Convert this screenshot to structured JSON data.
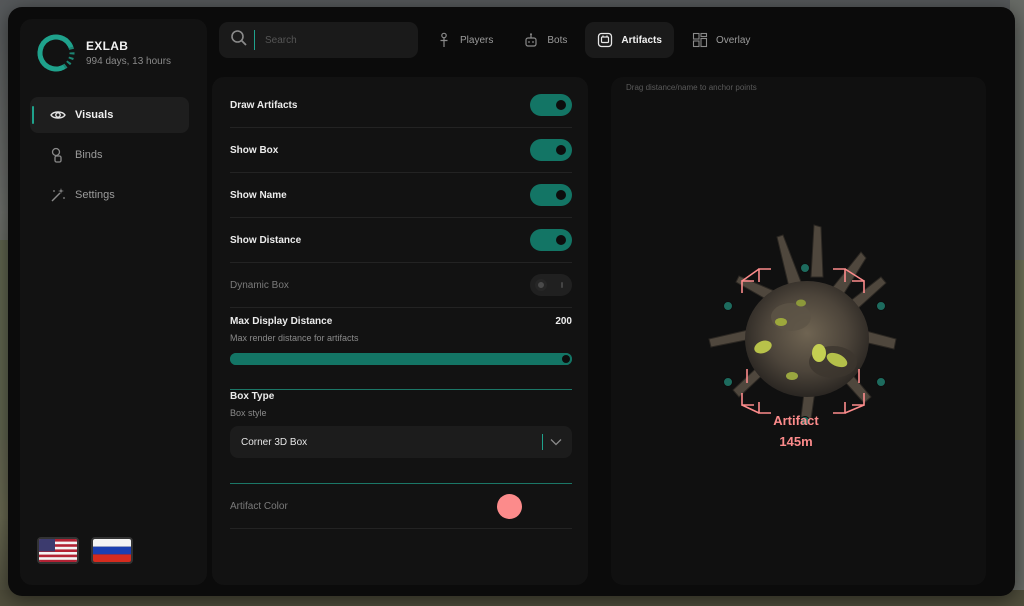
{
  "brand": {
    "name": "EXLAB",
    "subtitle": "994 days, 13 hours",
    "accent_color": "#1fa28c"
  },
  "sidebar": {
    "items": [
      {
        "label": "Visuals",
        "icon": "eye-icon",
        "active": true
      },
      {
        "label": "Binds",
        "icon": "keychain-icon",
        "active": false
      },
      {
        "label": "Settings",
        "icon": "magic-wand-icon",
        "active": false
      }
    ],
    "languages": [
      {
        "icon": "us-flag-icon"
      },
      {
        "icon": "ru-flag-icon"
      }
    ]
  },
  "search": {
    "placeholder": "Search",
    "value": ""
  },
  "tabs": [
    {
      "label": "Players",
      "icon": "player-icon",
      "active": false
    },
    {
      "label": "Bots",
      "icon": "bot-icon",
      "active": false
    },
    {
      "label": "Artifacts",
      "icon": "artifact-icon",
      "active": true
    },
    {
      "label": "Overlay",
      "icon": "overlay-icon",
      "active": false
    }
  ],
  "settings": {
    "draw_artifacts": {
      "label": "Draw Artifacts",
      "enabled": true
    },
    "show_box": {
      "label": "Show Box",
      "enabled": true
    },
    "show_name": {
      "label": "Show Name",
      "enabled": true
    },
    "show_distance": {
      "label": "Show Distance",
      "enabled": true
    },
    "dynamic_box": {
      "label": "Dynamic Box",
      "enabled": false,
      "disabled": true
    },
    "max_distance": {
      "label": "Max Display Distance",
      "value": "200",
      "description": "Max render distance for artifacts",
      "fill_fraction": 1.0
    },
    "box_type": {
      "label": "Box Type",
      "description": "Box style",
      "selected": "Corner 3D Box"
    },
    "artifact_color": {
      "label": "Artifact Color",
      "color": "#fc8b8b"
    }
  },
  "preview": {
    "hint": "Drag distance/name to anchor points",
    "name_label": "Artifact",
    "distance_label": "145m",
    "box_color": "#fc8b8b",
    "anchor_color": "#1fa28c"
  }
}
